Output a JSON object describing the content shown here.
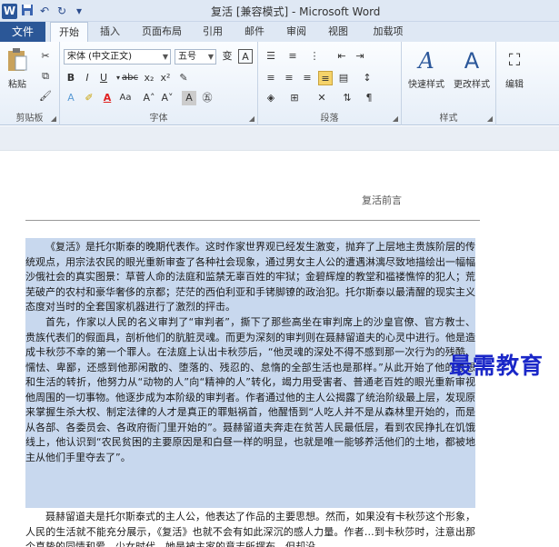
{
  "window": {
    "title": "复活 [兼容模式] - Microsoft Word"
  },
  "quick_access": {
    "app_icon": "W"
  },
  "tabs": [
    {
      "label": "文件"
    },
    {
      "label": "开始"
    },
    {
      "label": "插入"
    },
    {
      "label": "页面布局"
    },
    {
      "label": "引用"
    },
    {
      "label": "邮件"
    },
    {
      "label": "审阅"
    },
    {
      "label": "视图"
    },
    {
      "label": "加载项"
    }
  ],
  "ribbon": {
    "clipboard": {
      "label": "剪贴板",
      "paste": "粘贴"
    },
    "font": {
      "label": "字体",
      "font_name": "宋体 (中文正文)",
      "font_size": "五号"
    },
    "paragraph": {
      "label": "段落"
    },
    "styles": {
      "label": "样式",
      "quick_styles": "快速样式",
      "change_styles": "更改样式"
    },
    "editing": {
      "label": "编辑"
    }
  },
  "document": {
    "header": "复活前言",
    "paragraphs": [
      "《复活》是托尔斯泰的晚期代表作。这时作家世界观已经发生激变，抛弃了上层地主贵族阶层的传统观点，用宗法农民的眼光重新审查了各种社会现象，通过男女主人公的遭遇淋漓尽致地描绘出一幅幅沙俄社会的真实图景：草菅人命的法庭和监禁无辜百姓的牢狱；金碧辉煌的教堂和褴褛憔悴的犯人；荒芜破产的农村和豪华奢侈的京都；茫茫的西伯利亚和手铐脚镣的政治犯。托尔斯泰以最清醒的现实主义态度对当时的全套国家机器进行了激烈的抨击。",
      "首先，作家以人民的名义审判了“审判者”，撕下了那些高坐在审判席上的沙皇官僚、官方教士、贵族代表们的假面具，剖析他们的肮脏灵魂。而更为深刻的审判则在聂赫留道夫的心灵中进行。他是造成卡秋莎不幸的第一个罪人。在法庭上认出卡秋莎后，“他灵魂的深处不得不感到那一次行为的残酷、懦怯、卑鄙，还感到他那闲散的、堕落的、残忍的、怠惰的全部生活也是那样。”从此开始了他的思想和生活的转折，他努力从“动物的人”向“精神的人”转化，竭力用受害者、普通老百姓的眼光重新审视他周围的一切事物。他逐步成为本阶级的审判者。作者通过他的主人公揭露了统治阶级最上层，发现原来掌握生杀大权、制定法律的人才是真正的罪魁祸首，他醒悟到“人吃人并不是从森林里开始的，而是从各部、各委员会、各政府衙门里开始的”。聂赫留道夫奔走在贫苦人民最低层，看到农民挣扎在饥饿线上，他认识到“农民贫困的主要原因是和白昼一样的明显，也就是唯一能够养活他们的土地，都被地主从他们手里夺去了”。",
      "聂赫留道夫是托尔斯泰式的主人公，他表达了作品的主要思想。然而，如果没有卡秋莎这个形象，人民的生活就不能充分展示，《复活》也就不会有如此深沉的感人力量。作者…到卡秋莎时，注意出那个真挚的同情和爱，少女时代，她是被主家的意志所摆布，但却没"
    ]
  },
  "watermark": "最需教育"
}
